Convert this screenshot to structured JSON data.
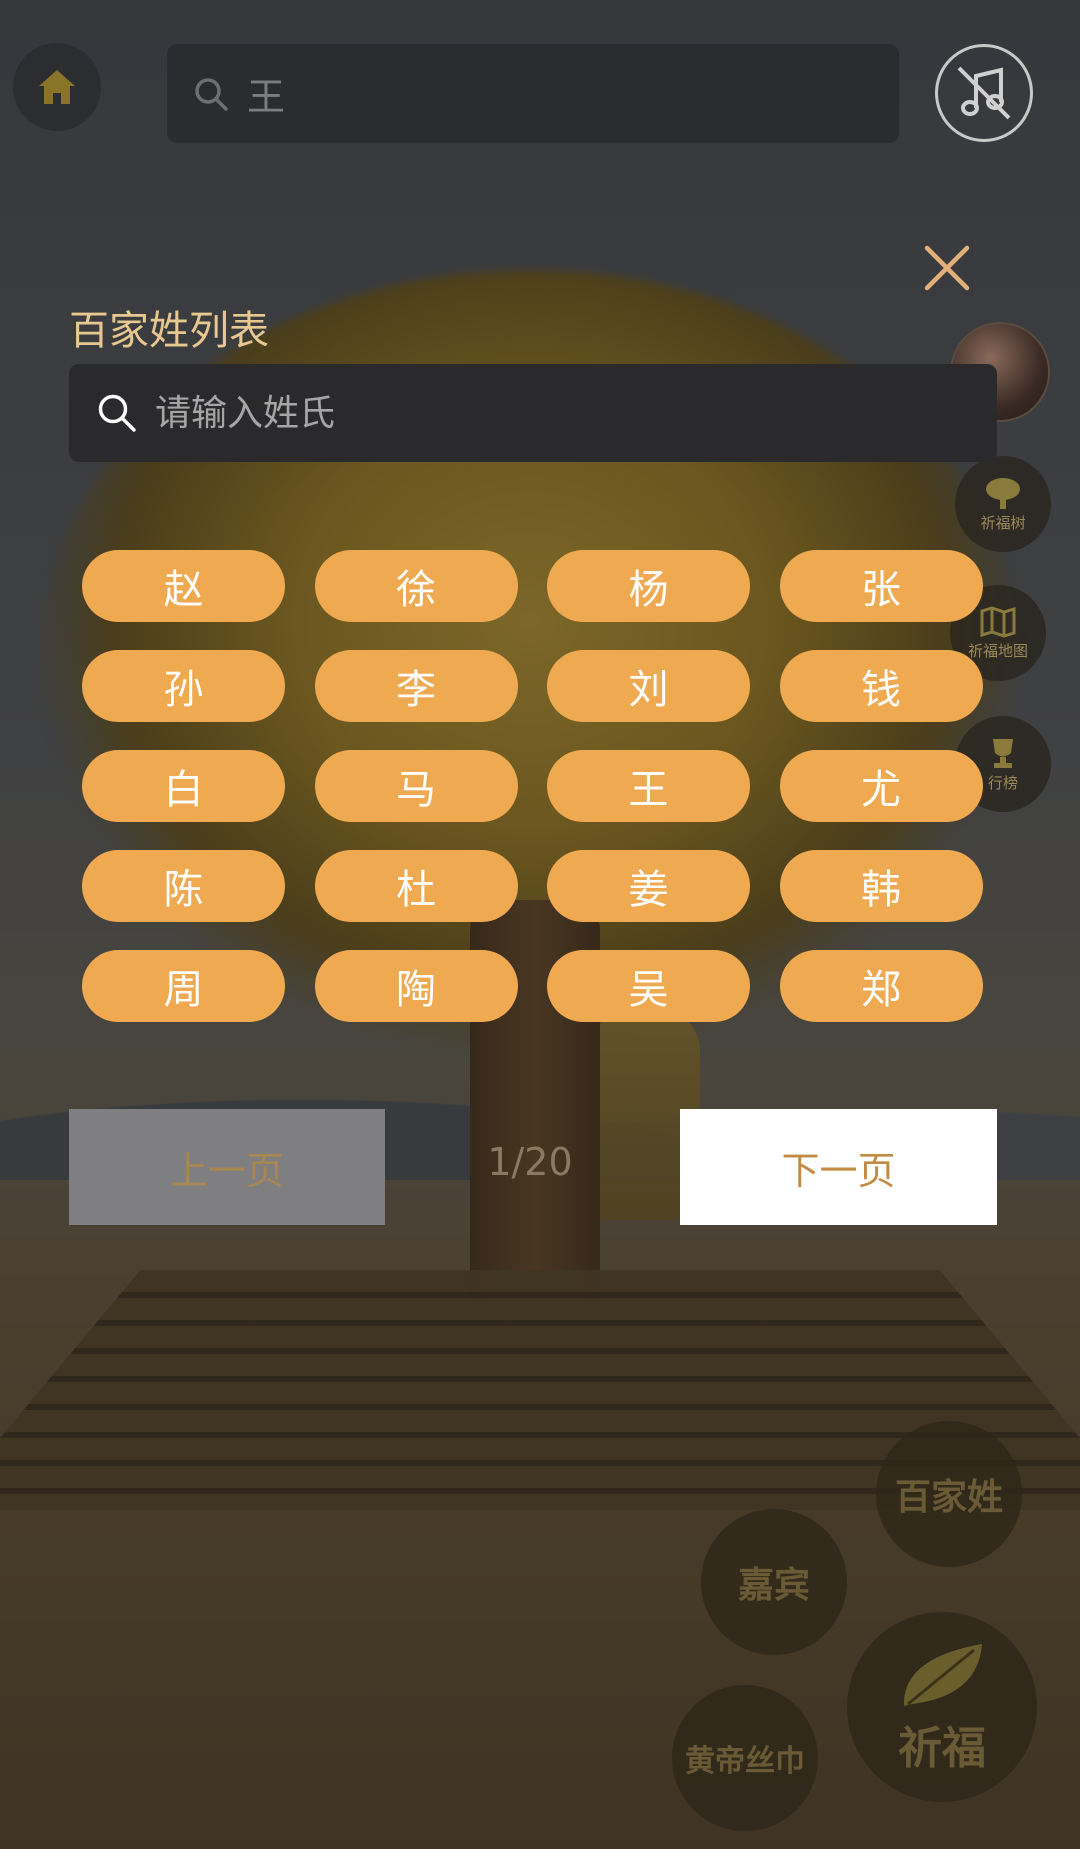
{
  "top_bar": {
    "search_value": "王"
  },
  "side": {
    "tree_label": "祈福树",
    "map_label": "祈福地图",
    "rank_label": "行榜"
  },
  "modal": {
    "title": "百家姓列表",
    "search_placeholder": "请输入姓氏",
    "surnames": [
      "赵",
      "徐",
      "杨",
      "张",
      "孙",
      "李",
      "刘",
      "钱",
      "白",
      "马",
      "王",
      "尤",
      "陈",
      "杜",
      "姜",
      "韩",
      "周",
      "陶",
      "吴",
      "郑"
    ],
    "prev_label": "上一页",
    "page_indicator": "1/20",
    "next_label": "下一页"
  },
  "bottom_menu": {
    "surnames_label": "百家姓",
    "guests_label": "嘉宾",
    "silk_label": "黄帝丝巾",
    "bless_label": "祈福"
  },
  "colors": {
    "accent_orange": "#efa950",
    "title_gold": "#e8c891",
    "next_text": "#c28c45"
  }
}
